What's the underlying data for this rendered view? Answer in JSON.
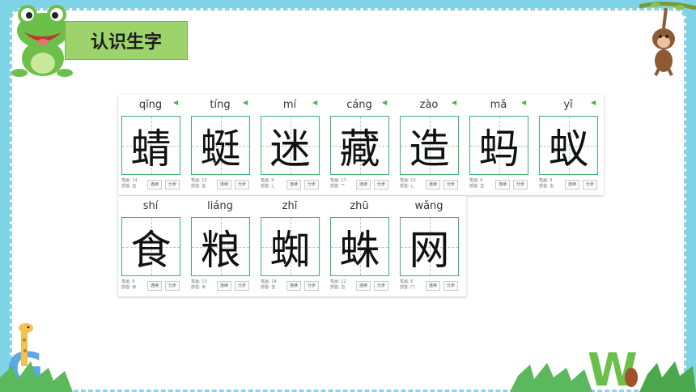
{
  "title": "认识生字",
  "characters_row1": [
    {
      "pinyin": "qīng",
      "char": "蜻",
      "meta1": "笔画: 14",
      "meta2": "部首: 虫"
    },
    {
      "pinyin": "tíng",
      "char": "蜓",
      "meta1": "笔画: 12",
      "meta2": "部首: 虫"
    },
    {
      "pinyin": "mí",
      "char": "迷",
      "meta1": "笔画: 9",
      "meta2": "部首: 辶"
    },
    {
      "pinyin": "cáng",
      "char": "藏",
      "meta1": "笔画: 17",
      "meta2": "部首: 艹"
    },
    {
      "pinyin": "zào",
      "char": "造",
      "meta1": "笔画: 10",
      "meta2": "部首: 辶"
    },
    {
      "pinyin": "mǎ",
      "char": "蚂",
      "meta1": "笔画: 9",
      "meta2": "部首: 虫"
    },
    {
      "pinyin": "yǐ",
      "char": "蚁",
      "meta1": "笔画: 9",
      "meta2": "部首: 虫"
    }
  ],
  "characters_row2": [
    {
      "pinyin": "shí",
      "char": "食",
      "meta1": "笔画: 9",
      "meta2": "部首: 食"
    },
    {
      "pinyin": "liáng",
      "char": "粮",
      "meta1": "笔画: 13",
      "meta2": "部首: 米"
    },
    {
      "pinyin": "zhī",
      "char": "蜘",
      "meta1": "笔画: 14",
      "meta2": "部首: 虫"
    },
    {
      "pinyin": "zhū",
      "char": "蛛",
      "meta1": "笔画: 12",
      "meta2": "部首: 虫"
    },
    {
      "pinyin": "wǎng",
      "char": "网",
      "meta1": "笔画: 6",
      "meta2": "部首: 冂"
    }
  ],
  "buttons": {
    "connect": "连续",
    "split": "分步"
  },
  "icons": {
    "speaker": "speaker-icon",
    "frog": "frog-mascot",
    "monkey": "monkey-mascot",
    "giraffe": "giraffe-decoration"
  },
  "colors": {
    "accent": "#3db36b",
    "title_bg": "#9dd36a",
    "frame": "#7fd3e6"
  }
}
